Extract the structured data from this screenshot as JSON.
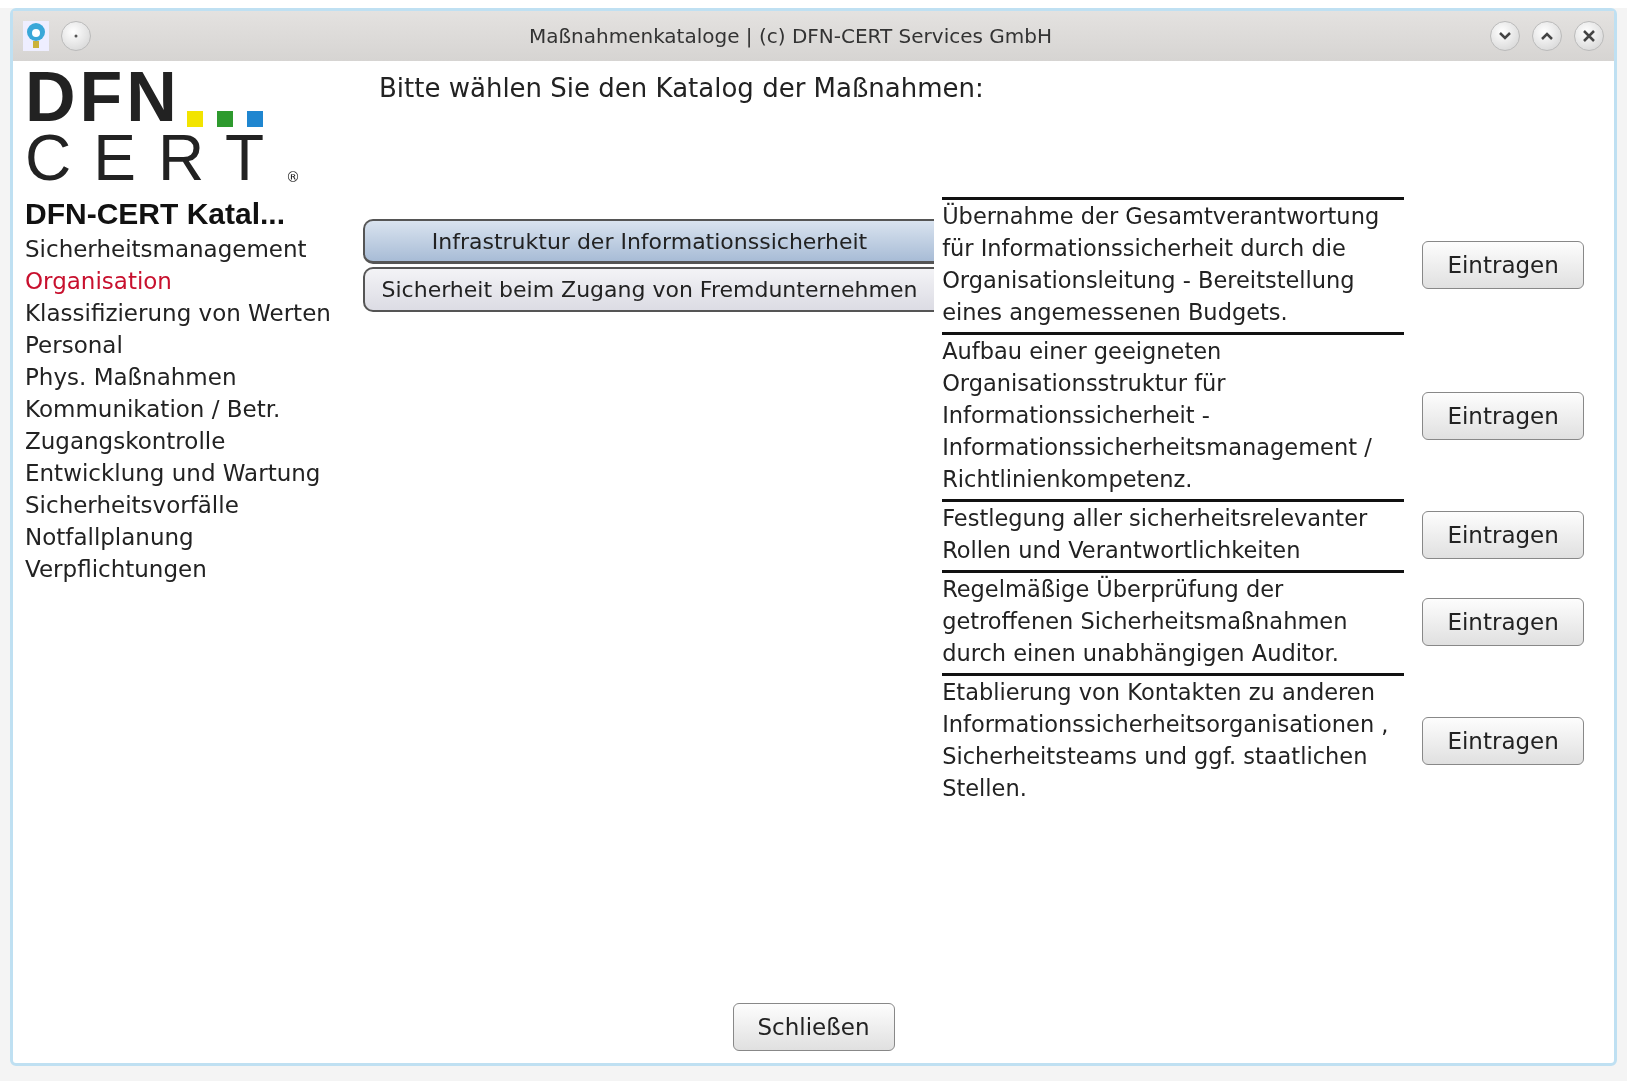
{
  "window": {
    "title": "Maßnahmenkataloge | (c) DFN-CERT Services GmbH"
  },
  "logo": {
    "line_1": "DFN",
    "line_2": "CERT",
    "mark": "®"
  },
  "prompt": "Bitte wählen Sie den Katalog der Maßnahmen:",
  "sidebar": {
    "title": "DFN-CERT Katal...",
    "items": [
      {
        "label": "Sicherheitsmanagement",
        "selected": false
      },
      {
        "label": "Organisation",
        "selected": true
      },
      {
        "label": "Klassifizierung von Werten",
        "selected": false
      },
      {
        "label": "Personal",
        "selected": false
      },
      {
        "label": "Phys. Maßnahmen",
        "selected": false
      },
      {
        "label": "Kommunikation / Betr.",
        "selected": false
      },
      {
        "label": "Zugangskontrolle",
        "selected": false
      },
      {
        "label": "Entwicklung und Wartung",
        "selected": false
      },
      {
        "label": "Sicherheitsvorfälle",
        "selected": false
      },
      {
        "label": "Notfallplanung",
        "selected": false
      },
      {
        "label": "Verpflichtungen",
        "selected": false
      }
    ]
  },
  "categories": [
    {
      "label": "Infrastruktur der Informationssicherheit",
      "selected": true
    },
    {
      "label": "Sicherheit beim Zugang von Fremdunternehmen",
      "selected": false
    }
  ],
  "measures": [
    {
      "text": "Übernahme der Gesamtverantwortung für Informationssicherheit durch die Organisationsleitung - Bereitstellung eines angemessenen Budgets.",
      "button": "Eintragen"
    },
    {
      "text": "Aufbau einer geeigneten Organisationsstruktur für Informationssicherheit - Informationssicherheitsmanagement / Richtlinienkompetenz.",
      "button": "Eintragen"
    },
    {
      "text": "Festlegung aller sicherheitsrelevanter Rollen und Verantwortlichkeiten",
      "button": "Eintragen"
    },
    {
      "text": "Regelmäßige Überprüfung der getroffenen Sicherheitsmaßnahmen durch einen unabhängigen Auditor.",
      "button": "Eintragen"
    },
    {
      "text": "Etablierung von Kontakten zu anderen Informationssicherheitsorganisationen , Sicherheitsteams und ggf. staatlichen Stellen.",
      "button": "Eintragen"
    }
  ],
  "close_button": "Schließen"
}
